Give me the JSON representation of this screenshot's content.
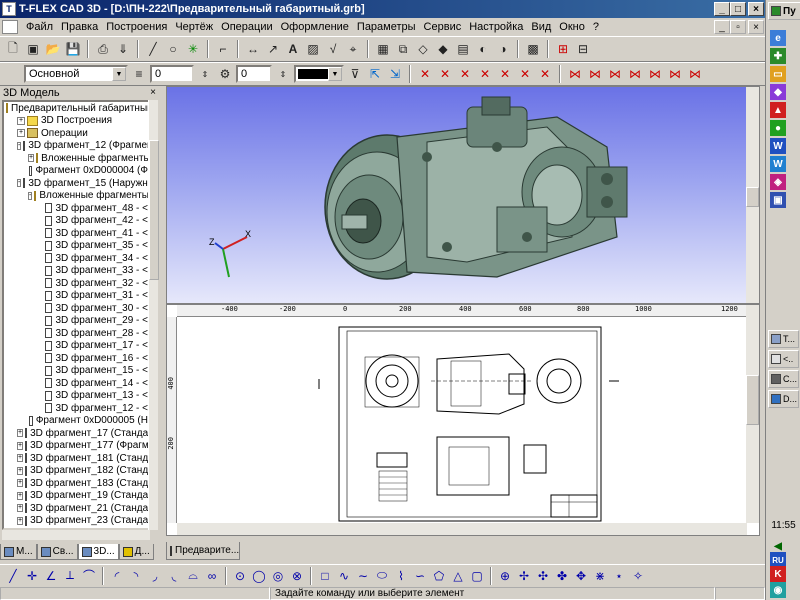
{
  "window": {
    "title": "T-FLEX CAD 3D - [D:\\ПН-222\\Предварительный габаритный.grb]",
    "minimize": "_",
    "maximize": "□",
    "close": "×"
  },
  "menu": {
    "items": [
      "Файл",
      "Правка",
      "Построения",
      "Чертёж",
      "Операции",
      "Оформление",
      "Параметры",
      "Сервис",
      "Настройка",
      "Вид",
      "Окно",
      "?"
    ],
    "doc_minimize": "_",
    "doc_restore": "▫",
    "doc_close": "×"
  },
  "toolbar2": {
    "layer": "Основной",
    "value1": "0",
    "value2": "0"
  },
  "model_panel": {
    "title": "3D Модель",
    "close": "×",
    "tree": [
      {
        "indent": 0,
        "exp": "",
        "icon": "folder",
        "label": "Предварительный габаритный.g"
      },
      {
        "indent": 1,
        "exp": "+",
        "icon": "folder",
        "label": "3D Построения"
      },
      {
        "indent": 1,
        "exp": "+",
        "icon": "ops",
        "label": "Операции"
      },
      {
        "indent": 1,
        "exp": "-",
        "icon": "frag",
        "label": "3D фрагмент_12 (Фрагмент"
      },
      {
        "indent": 2,
        "exp": "+",
        "icon": "folder",
        "label": "Вложенные фрагменты"
      },
      {
        "indent": 2,
        "exp": "",
        "icon": "frag",
        "label": "Фрагмент 0xD000004 (Ф"
      },
      {
        "indent": 1,
        "exp": "-",
        "icon": "frag",
        "label": "3D фрагмент_15 (Наружн кр"
      },
      {
        "indent": 2,
        "exp": "-",
        "icon": "folder",
        "label": "Вложенные фрагменты"
      },
      {
        "indent": 3,
        "exp": "",
        "icon": "frag",
        "label": "3D фрагмент_48 - <"
      },
      {
        "indent": 3,
        "exp": "",
        "icon": "frag",
        "label": "3D фрагмент_42 - <"
      },
      {
        "indent": 3,
        "exp": "",
        "icon": "frag",
        "label": "3D фрагмент_41 - <"
      },
      {
        "indent": 3,
        "exp": "",
        "icon": "frag",
        "label": "3D фрагмент_35 - <"
      },
      {
        "indent": 3,
        "exp": "",
        "icon": "frag",
        "label": "3D фрагмент_34 - <"
      },
      {
        "indent": 3,
        "exp": "",
        "icon": "frag",
        "label": "3D фрагмент_33 - <"
      },
      {
        "indent": 3,
        "exp": "",
        "icon": "frag",
        "label": "3D фрагмент_32 - <"
      },
      {
        "indent": 3,
        "exp": "",
        "icon": "frag",
        "label": "3D фрагмент_31 - <"
      },
      {
        "indent": 3,
        "exp": "",
        "icon": "frag",
        "label": "3D фрагмент_30 - <"
      },
      {
        "indent": 3,
        "exp": "",
        "icon": "frag",
        "label": "3D фрагмент_29 - <"
      },
      {
        "indent": 3,
        "exp": "",
        "icon": "frag",
        "label": "3D фрагмент_28 - <"
      },
      {
        "indent": 3,
        "exp": "",
        "icon": "frag",
        "label": "3D фрагмент_17 - <"
      },
      {
        "indent": 3,
        "exp": "",
        "icon": "frag",
        "label": "3D фрагмент_16 - <"
      },
      {
        "indent": 3,
        "exp": "",
        "icon": "frag",
        "label": "3D фрагмент_15 - <"
      },
      {
        "indent": 3,
        "exp": "",
        "icon": "frag",
        "label": "3D фрагмент_14 - <"
      },
      {
        "indent": 3,
        "exp": "",
        "icon": "frag",
        "label": "3D фрагмент_13 - <"
      },
      {
        "indent": 3,
        "exp": "",
        "icon": "frag",
        "label": "3D фрагмент_12 - <"
      },
      {
        "indent": 2,
        "exp": "",
        "icon": "frag",
        "label": "Фрагмент 0xD000005 (Н"
      },
      {
        "indent": 1,
        "exp": "+",
        "icon": "frag",
        "label": "3D фрагмент_17 (Стандарт"
      },
      {
        "indent": 1,
        "exp": "+",
        "icon": "frag",
        "label": "3D фрагмент_177 (Фрагмен"
      },
      {
        "indent": 1,
        "exp": "+",
        "icon": "frag",
        "label": "3D фрагмент_181 (Стандарт"
      },
      {
        "indent": 1,
        "exp": "+",
        "icon": "frag",
        "label": "3D фрагмент_182 (Стандарт"
      },
      {
        "indent": 1,
        "exp": "+",
        "icon": "frag",
        "label": "3D фрагмент_183 (Стандарт"
      },
      {
        "indent": 1,
        "exp": "+",
        "icon": "frag",
        "label": "3D фрагмент_19 (Стандарт"
      },
      {
        "indent": 1,
        "exp": "+",
        "icon": "frag",
        "label": "3D фрагмент_21 (Стандарт"
      },
      {
        "indent": 1,
        "exp": "+",
        "icon": "frag",
        "label": "3D фрагмент_23 (Стандарт"
      }
    ],
    "tabs": [
      "М...",
      "Св...",
      "3D...",
      "Д..."
    ]
  },
  "ruler_h": [
    "-400",
    "-200",
    "0",
    "200",
    "400",
    "600",
    "800",
    "1000",
    "1200"
  ],
  "ruler_v": [
    "400",
    "200"
  ],
  "doc_tab": "Предварите...",
  "status": {
    "prompt": "Задайте команду или выберите элемент"
  },
  "taskbar": {
    "start": "Пу",
    "tasks": [
      "T...",
      "<..",
      "C...",
      "D..."
    ],
    "lang": "RU",
    "clock": "11:55"
  }
}
